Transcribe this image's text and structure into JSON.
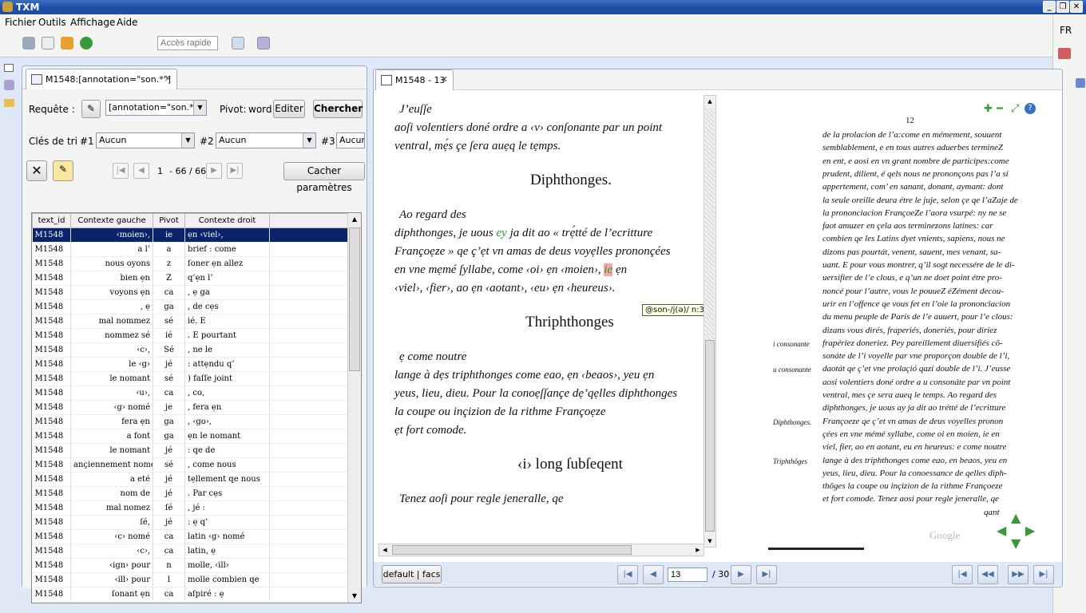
{
  "window": {
    "title": "TXM"
  },
  "menu": [
    "Fichier",
    "Outils",
    "Affichage",
    "Aide"
  ],
  "toolbar": {
    "quick_access_placeholder": "Accès rapide"
  },
  "lang": "FR",
  "concordance": {
    "tab_label": "M1548:[annotation=\"son.*\"]",
    "query_label": "Requête :",
    "query_value": "[annotation=\"son.*\"]",
    "pivot_label": "Pivot:",
    "pivot_value": "word",
    "edit_button": "Editer",
    "search_button": "Chercher",
    "sort_label": "Clés de tri :",
    "sort_keys": [
      {
        "label": "#1",
        "value": "Aucun"
      },
      {
        "label": "#2",
        "value": "Aucun"
      },
      {
        "label": "#3",
        "value": "Aucun"
      }
    ],
    "pager": {
      "start": "1",
      "range": "- 66 / 66"
    },
    "hide_params_button": "Cacher paramètres",
    "columns": [
      "text_id",
      "Contexte gauche",
      "Pivot",
      "Contexte droit"
    ],
    "rows": [
      [
        "M1548",
        "‹moien›,",
        "ie",
        "ẹn ‹viel›,"
      ],
      [
        "M1548",
        "a l’",
        "a",
        "brief : come"
      ],
      [
        "M1548",
        "nous oyons",
        "z",
        "ſoner ẹn allez"
      ],
      [
        "M1548",
        "bien ẹn",
        "Z",
        "q’ẹn l’"
      ],
      [
        "M1548",
        "voyons ẹn",
        "ca",
        ", ẹ ga"
      ],
      [
        "M1548",
        ", ẹ",
        "ga",
        ", de cẹs"
      ],
      [
        "M1548",
        "mal nommez",
        "sé",
        "ié. E"
      ],
      [
        "M1548",
        "nommez sé",
        "ié",
        ". E pourtant"
      ],
      [
        "M1548",
        "‹c›,",
        "Sé",
        ", ne le"
      ],
      [
        "M1548",
        "le ‹g›",
        "jé",
        ": attẹndu q’"
      ],
      [
        "M1548",
        "le nomant",
        "sé",
        ") faſſe joint"
      ],
      [
        "M1548",
        "‹u›,",
        "ca",
        ", co,"
      ],
      [
        "M1548",
        "‹g› nomé",
        "je",
        ", fera ẹn"
      ],
      [
        "M1548",
        "fera ẹn",
        "ga",
        ", ‹go›,"
      ],
      [
        "M1548",
        "a font",
        "ga",
        "ẹn le nomant"
      ],
      [
        "M1548",
        "le nomant",
        "jé",
        ": qe de"
      ],
      [
        "M1548",
        "ançiennement nomé",
        "sé",
        ", come nous"
      ],
      [
        "M1548",
        "a eté",
        "jé",
        "tẹllement qe nous"
      ],
      [
        "M1548",
        "nom de",
        "jé",
        ". Par cẹs"
      ],
      [
        "M1548",
        "mal nomez",
        "ſé",
        ", jé :"
      ],
      [
        "M1548",
        "ſé,",
        "jé",
        ": ẹ q’"
      ],
      [
        "M1548",
        "‹c› nomé",
        "ca",
        "latin ‹g› nomé"
      ],
      [
        "M1548",
        "‹c›,",
        "ca",
        "latin, ẹ"
      ],
      [
        "M1548",
        "‹ign› pour",
        "n",
        "molle, ‹ill›"
      ],
      [
        "M1548",
        "‹ill› pour",
        "l",
        "molle combien qe"
      ],
      [
        "M1548",
        "ſonant ẹn",
        "ca",
        "aſpiré : ẹ"
      ]
    ]
  },
  "edition": {
    "tab_label": "M1548 - 13",
    "text_lines": [
      "J’euſſe",
      "aoſi volentiers doné ordre a ‹v› conſonante par un point",
      "ventral, mẹ́s çe ſera auẹq le tẹmps."
    ],
    "heading1": "Diphthonges.",
    "para2": [
      "Ao regard des",
      "diphthonges, je uous ",
      "ey",
      " ja dit ao « trẹ́tté de l’ecritture",
      "Françoẹze » qe ç’ẹt vn amas de deus voyẹlles prononçées",
      "en vne mẹmé ſyllabe, come ‹oi› ẹn ‹moien›, ",
      "ie",
      " ẹn",
      "‹viel›, ‹fier›, ao ẹn ‹aotant›, ‹eu› ẹn ‹heureus›."
    ],
    "tooltip": "@son-/j(ə)/ n:3210",
    "heading2": "Thriphthonges",
    "para3": [
      "ẹ come noutre",
      "lange à dẹs triphthonges come eao, ẹn ‹beaos›, yeu ẹn",
      "yeus, lieu, dieu. Pour la conoẹſſançe dẹ’qẹlles diphthonges",
      "la coupe ou inçizion de la rithme Françoẹze",
      "ẹt fort comode."
    ],
    "heading3": "‹i› long ſubſeqent",
    "para4": "Tenez aoſi pour regle jeneralle, qe",
    "view_button": "default | facs",
    "page_current": "13",
    "page_total": "/ 30",
    "facsimile": {
      "page_number": "12",
      "lines": [
        "de la prolacion de l’a:come en mémement, souuent",
        "semblablement, e en tous autres aduerbes termineZ",
        "en ent, e aosi en vn grant nombre de participes:come",
        "prudent, dilient, é qels nous ne prononçons pas l’a si",
        "appertement, com’ en sanant, donant, aymant: dont",
        "la seule oreille deura étre le juje, selon çe qe l’aZaje de",
        "la prononciacion FrançoeZe l’aora vsurpé: ny ne se",
        "faot amuzer en çela aos terminezons latines: car",
        "combien qe les Latins dyet vnients, sapiens, nous ne",
        "dizons pas pourtát, venent, sauent, mes venant, sa-",
        "uant. E pour vous montrer, q’il sogt necessére de le di-",
        "uersifier de l’e clous, e q’un ne doet point étre pro-",
        "noncé pour l’autre, vous le pouueZ éZément decou-",
        "urir en l’offence qe vous fet en l’oie la prononciacion",
        "du menu peuple de Paris de l’e auuert, pour l’e clous:",
        "dizans vous dirés, fraperiés, doneriés, pour diriez",
        "frapériez doneriez. Pey pareillement diuersifiés cō-",
        "sonáte de l’i voyelle par vne proporçon double de l’i,",
        "daotát qe ç’et vne prolaçió qazi double de l’i. J’eusse",
        "aosi volentiers doné ordre a u consonáte par vn point",
        "ventral, mes çe sera aueq le temps. Ao regard des",
        "diphthonges, je uous ay ja dit ao trétté de l’ecritture",
        "Françoeze qe ç’et vn amas de deus voyelles pronon",
        "çées en vne mémé syllabe, come oi en moien, ie en",
        "viel, fier, ao en aotant, eu en heureus: e come noutre",
        "lange à des triphthonges come eao, en beaos, yeu en",
        "yeus, lieu, dieu. Pour la conoessance de qelles diph-",
        "thôges la coupe ou inçizion de la rithme Françoeze",
        "et fort comode. Tenez aosi pour regle jeneralle, qe",
        "qant"
      ],
      "margin_notes": [
        {
          "text": "i consonante",
          "line": 16
        },
        {
          "text": "u consonante",
          "line": 18
        },
        {
          "text": "Diphthonges.",
          "line": 22
        },
        {
          "text": "Triphthôges",
          "line": 25
        }
      ],
      "watermark": "Google"
    }
  }
}
